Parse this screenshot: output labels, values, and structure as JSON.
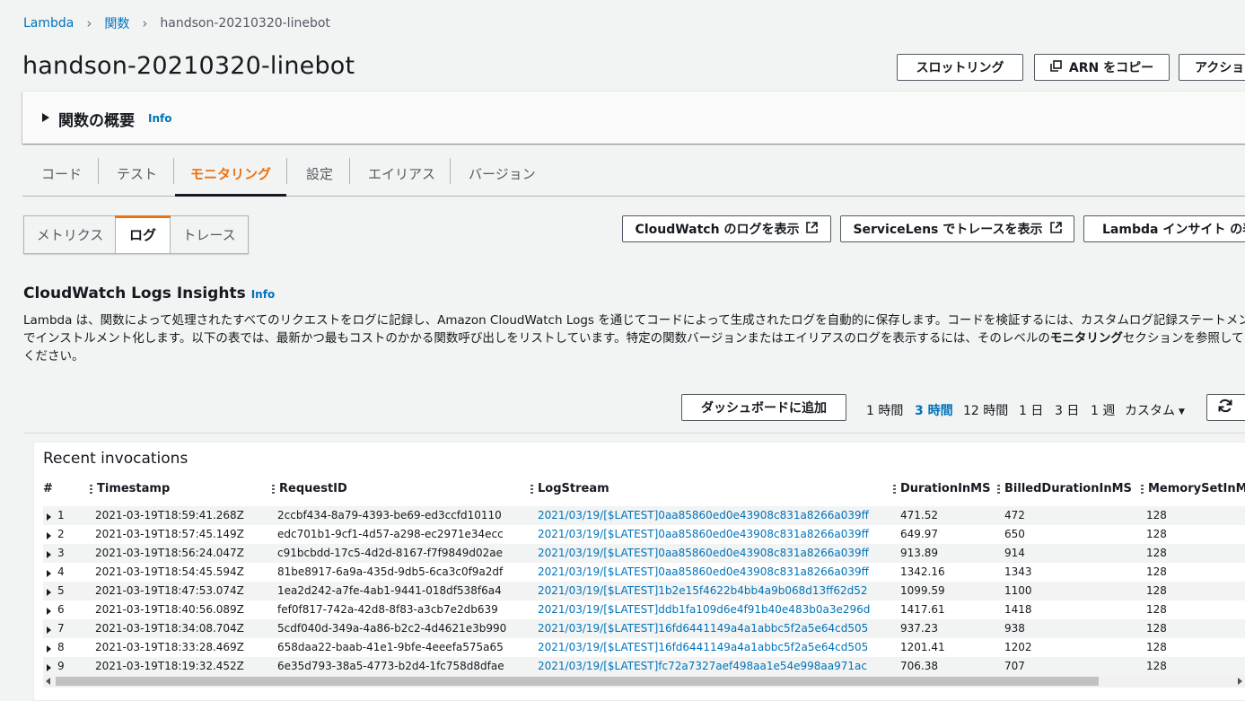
{
  "breadcrumb": {
    "items": [
      "Lambda",
      "関数"
    ],
    "current": "handson-20210320-linebot"
  },
  "page_title": "handson-20210320-linebot",
  "header_buttons": {
    "throttle": "スロットリング",
    "copy_arn": "ARN をコピー",
    "actions": "アクション"
  },
  "overview": {
    "title": "関数の概要",
    "info": "Info"
  },
  "tabs": [
    "コード",
    "テスト",
    "モニタリング",
    "設定",
    "エイリアス",
    "バージョン"
  ],
  "subtabs": [
    "メトリクス",
    "ログ",
    "トレース"
  ],
  "link_buttons": {
    "cloudwatch_logs": "CloudWatch のログを表示",
    "servicelens": "ServiceLens でトレースを表示",
    "lambda_insights": "Lambda インサイト の表示"
  },
  "insights": {
    "title": "CloudWatch Logs Insights",
    "info": "Info",
    "desc_line1": "Lambda は、関数によって処理されたすべてのリクエストをログに記録し、Amazon CloudWatch Logs を通じてコードによって生成されたログを自動的に保存します。コードを検証するには、カスタムログ記録ステートメント",
    "desc_line2_a": "でインストルメント化します。以下の表では、最新かつ最もコストのかかる関数呼び出しをリストしています。特定の関数バージョンまたはエイリアスのログを表示するには、そのレベルの",
    "desc_line2_bold": "モニタリング",
    "desc_line2_b": "セクションを参照して",
    "desc_line3": "ください。"
  },
  "add_dashboard": "ダッシュボードに追加",
  "time_ranges": [
    "1 時間",
    "3 時間",
    "12 時間",
    "1 日",
    "3 日",
    "1 週",
    "カスタム"
  ],
  "active_range": "3 時間",
  "table": {
    "title": "Recent invocations",
    "columns": [
      "#",
      "Timestamp",
      "RequestID",
      "LogStream",
      "DurationInMS",
      "BilledDurationInMS",
      "MemorySetInMB"
    ],
    "rows": [
      {
        "n": "1",
        "ts": "2021-03-19T18:59:41.268Z",
        "req": "2ccbf434-8a79-4393-be69-ed3ccfd10110",
        "log": "2021/03/19/[$LATEST]0aa85860ed0e43908c831a8266a039ff",
        "dur": "471.52",
        "billed": "472",
        "mem": "128"
      },
      {
        "n": "2",
        "ts": "2021-03-19T18:57:45.149Z",
        "req": "edc701b1-9cf1-4d57-a298-ec2971e34ecc",
        "log": "2021/03/19/[$LATEST]0aa85860ed0e43908c831a8266a039ff",
        "dur": "649.97",
        "billed": "650",
        "mem": "128"
      },
      {
        "n": "3",
        "ts": "2021-03-19T18:56:24.047Z",
        "req": "c91bcbdd-17c5-4d2d-8167-f7f9849d02ae",
        "log": "2021/03/19/[$LATEST]0aa85860ed0e43908c831a8266a039ff",
        "dur": "913.89",
        "billed": "914",
        "mem": "128"
      },
      {
        "n": "4",
        "ts": "2021-03-19T18:54:45.594Z",
        "req": "81be8917-6a9a-435d-9db5-6ca3c0f9a2df",
        "log": "2021/03/19/[$LATEST]0aa85860ed0e43908c831a8266a039ff",
        "dur": "1342.16",
        "billed": "1343",
        "mem": "128"
      },
      {
        "n": "5",
        "ts": "2021-03-19T18:47:53.074Z",
        "req": "1ea2d242-a7fe-4ab1-9441-018df538f6a4",
        "log": "2021/03/19/[$LATEST]1b2e15f4622b4bb4a9b068d13ff62d52",
        "dur": "1099.59",
        "billed": "1100",
        "mem": "128"
      },
      {
        "n": "6",
        "ts": "2021-03-19T18:40:56.089Z",
        "req": "fef0f817-742a-42d8-8f83-a3cb7e2db639",
        "log": "2021/03/19/[$LATEST]ddb1fa109d6e4f91b40e483b0a3e296d",
        "dur": "1417.61",
        "billed": "1418",
        "mem": "128"
      },
      {
        "n": "7",
        "ts": "2021-03-19T18:34:08.704Z",
        "req": "5cdf040d-349a-4a86-b2c2-4d4621e3b990",
        "log": "2021/03/19/[$LATEST]16fd6441149a4a1abbc5f2a5e64cd505",
        "dur": "937.23",
        "billed": "938",
        "mem": "128"
      },
      {
        "n": "8",
        "ts": "2021-03-19T18:33:28.469Z",
        "req": "658daa22-baab-41e1-9bfe-4eeefa575a65",
        "log": "2021/03/19/[$LATEST]16fd6441149a4a1abbc5f2a5e64cd505",
        "dur": "1201.41",
        "billed": "1202",
        "mem": "128"
      },
      {
        "n": "9",
        "ts": "2021-03-19T18:19:32.452Z",
        "req": "6e35d793-38a5-4773-b2d4-1fc758d8dfae",
        "log": "2021/03/19/[$LATEST]fc72a7327aef498aa1e54e998aa971ac",
        "dur": "706.38",
        "billed": "707",
        "mem": "128"
      }
    ]
  },
  "colors": {
    "accent": "#ec7211",
    "link": "#0073bb",
    "text": "#16191f",
    "background": "#f2f3f3"
  },
  "icons": [
    "chevron-right-icon",
    "caret-right-icon",
    "copy-icon",
    "external-link-icon",
    "caret-down-icon",
    "refresh-icon",
    "column-grip-icon",
    "scroll-left-icon",
    "scroll-right-icon"
  ]
}
